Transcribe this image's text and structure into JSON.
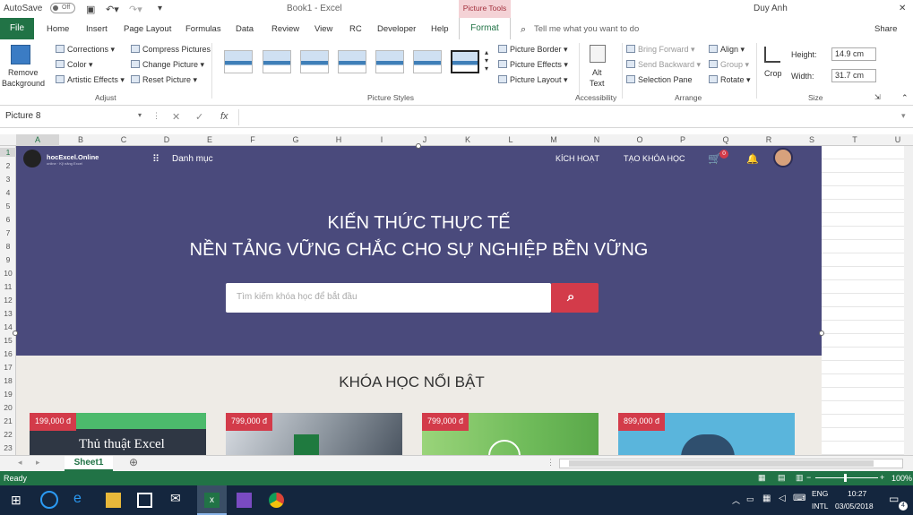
{
  "titlebar": {
    "autosave": "AutoSave",
    "autosave_state": "Off",
    "title": "Book1 - Excel",
    "user": "Duy Anh",
    "picture_tools": "Picture Tools"
  },
  "tabs": [
    "File",
    "Home",
    "Insert",
    "Page Layout",
    "Formulas",
    "Data",
    "Review",
    "View",
    "RC",
    "Developer",
    "Help",
    "Format"
  ],
  "tellme": "Tell me what you want to do",
  "share": "Share",
  "ribbon": {
    "remove_bg": [
      "Remove",
      "Background"
    ],
    "adjust": {
      "corrections": "Corrections ▾",
      "color": "Color ▾",
      "artistic": "Artistic Effects ▾",
      "compress": "Compress Pictures",
      "change": "Change Picture ▾",
      "reset": "Reset Picture ▾",
      "label": "Adjust"
    },
    "styles_label": "Picture Styles",
    "style_menu": {
      "border": "Picture Border ▾",
      "effects": "Picture Effects ▾",
      "layout": "Picture Layout ▾"
    },
    "accessibility": {
      "alt": [
        "Alt",
        "Text"
      ],
      "label": "Accessibility"
    },
    "arrange": {
      "forward": "Bring Forward ▾",
      "backward": "Send Backward ▾",
      "pane": "Selection Pane",
      "align": "Align ▾",
      "group": "Group ▾",
      "rotate": "Rotate ▾",
      "label": "Arrange"
    },
    "crop": "Crop",
    "size": {
      "height_label": "Height:",
      "height": "14.9 cm",
      "width_label": "Width:",
      "width": "31.7 cm",
      "label": "Size"
    }
  },
  "formula": {
    "namebox": "Picture 8",
    "fx": "fx"
  },
  "columns": [
    "A",
    "B",
    "C",
    "D",
    "E",
    "F",
    "G",
    "H",
    "I",
    "J",
    "K",
    "L",
    "M",
    "N",
    "O",
    "P",
    "Q",
    "R",
    "S",
    "T",
    "U"
  ],
  "rows": [
    "1",
    "2",
    "3",
    "4",
    "5",
    "6",
    "7",
    "8",
    "9",
    "10",
    "11",
    "12",
    "13",
    "14",
    "15",
    "16",
    "17",
    "18",
    "19",
    "20",
    "21",
    "22",
    "23"
  ],
  "site": {
    "logo": "hocExcel.Online",
    "logo_sub": "online · Kỹ năng Excel",
    "menu": "Danh mục",
    "nav": {
      "activate": "KÍCH HOẠT",
      "create": "TẠO KHÓA HỌC",
      "cart_count": "0"
    },
    "hero_line1": "KIẾN THỨC THỰC TẾ",
    "hero_line2": "NỀN TẢNG VỮNG CHẮC CHO SỰ NGHIỆP BỀN VỮNG",
    "search_placeholder": "Tìm kiếm khóa học để bắt đầu",
    "section_title": "KHÓA HỌC NỔI BẬT",
    "cards": [
      {
        "price": "199,000 đ",
        "title": "Thủ thuật Excel"
      },
      {
        "price": "799,000 đ"
      },
      {
        "price": "799,000 đ"
      },
      {
        "price": "899,000 đ"
      }
    ]
  },
  "sheet": {
    "tab": "Sheet1"
  },
  "status": {
    "ready": "Ready",
    "zoom": "100%"
  },
  "taskbar": {
    "lang1": "ENG",
    "lang2": "INTL",
    "time": "10:27",
    "date": "03/05/2018",
    "notif": "4"
  },
  "colors": {
    "excel_green": "#217346",
    "hero": "#4a4a7c",
    "accent_red": "#d33b4a",
    "lower_bg": "#eeebe6"
  }
}
